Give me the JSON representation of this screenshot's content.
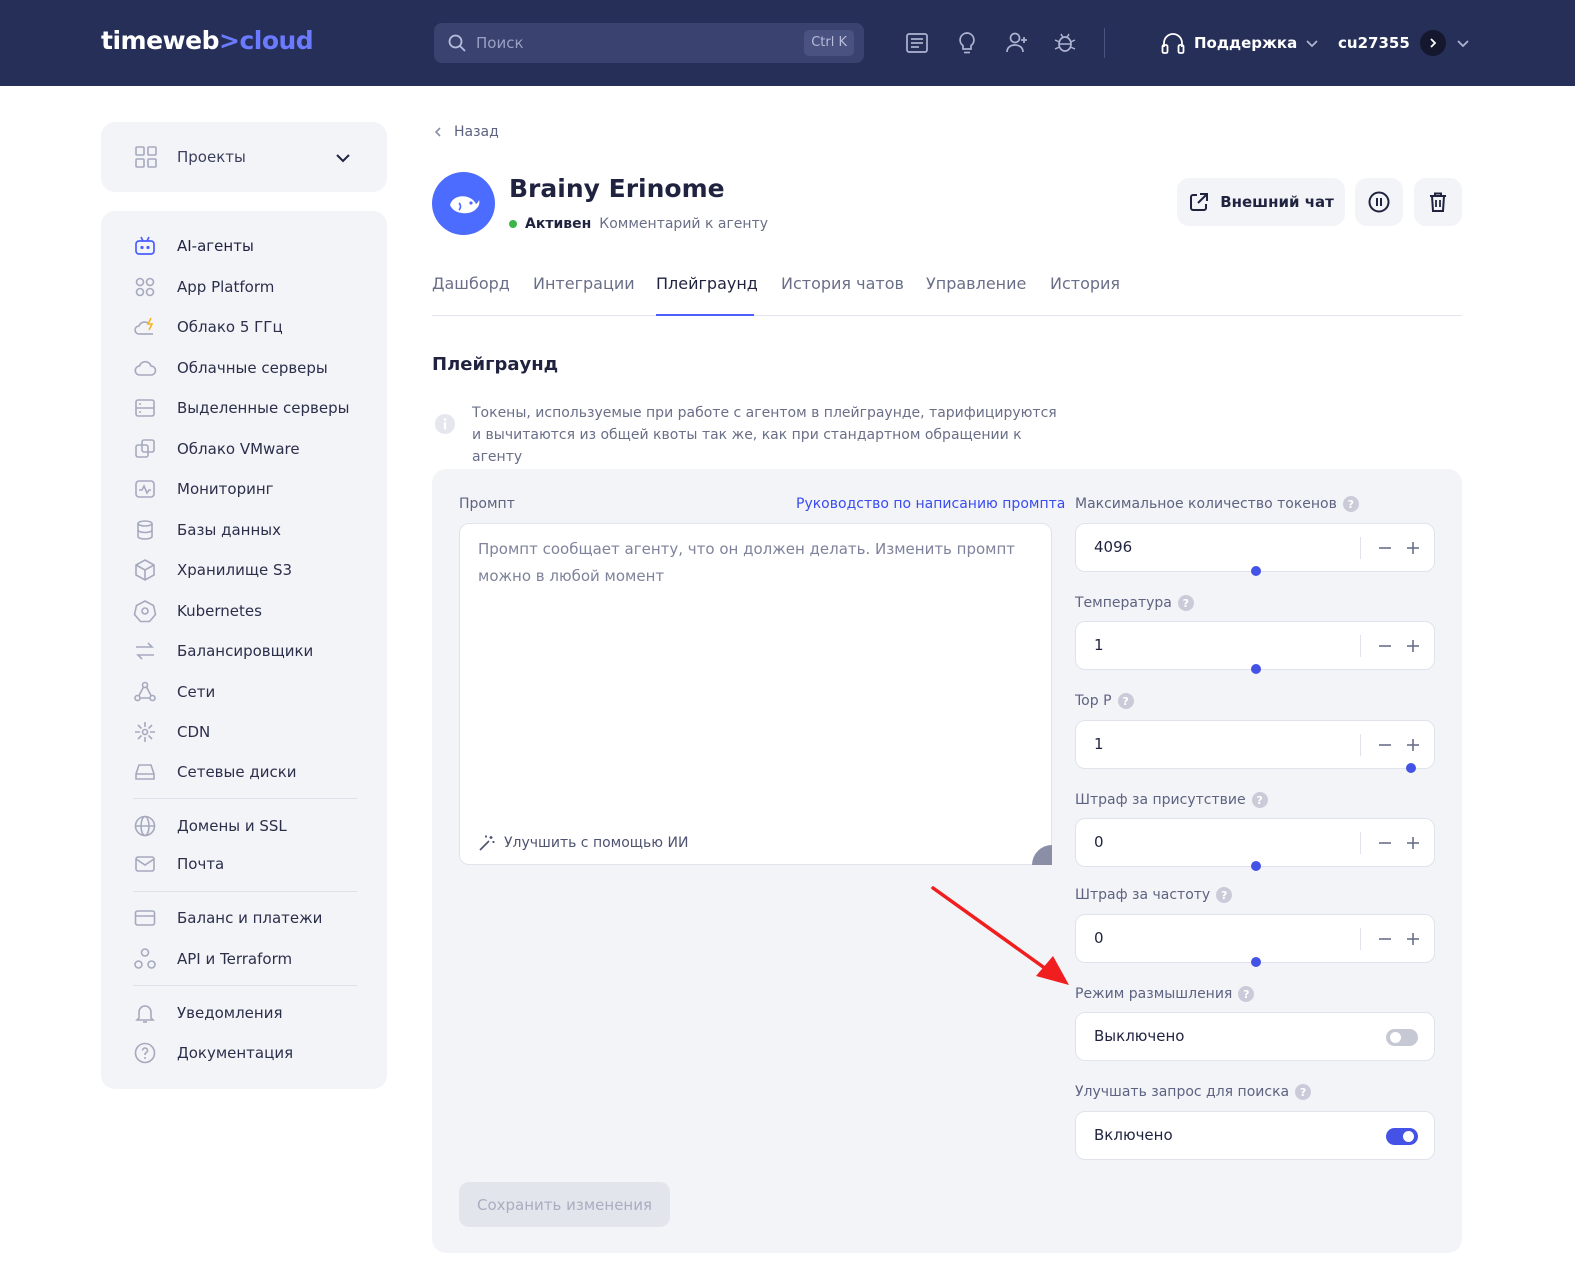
{
  "header": {
    "logo_main": "timeweb",
    "logo_sep": ">",
    "logo_accent": "cloud",
    "search_placeholder": "Поиск",
    "search_shortcut": "Ctrl K",
    "icons": [
      "news-icon",
      "lightbulb-icon",
      "add-user-icon",
      "bug-icon"
    ],
    "support_label": "Поддержка",
    "account_id": "cu27355",
    "bg_color": "#262f57",
    "accent_color": "#6b7bff"
  },
  "sidebar": {
    "projects_label": "Проекты",
    "items": [
      {
        "label": "AI-агенты",
        "icon": "robot-icon"
      },
      {
        "label": "App Platform",
        "icon": "grid-icon"
      },
      {
        "label": "Облако 5 ГГц",
        "icon": "cloud-bolt-icon"
      },
      {
        "label": "Облачные серверы",
        "icon": "cloud-icon"
      },
      {
        "label": "Выделенные серверы",
        "icon": "server-icon"
      },
      {
        "label": "Облако VMware",
        "icon": "vmware-icon"
      },
      {
        "label": "Мониторинг",
        "icon": "monitoring-icon"
      },
      {
        "label": "Базы данных",
        "icon": "database-icon"
      },
      {
        "label": "Хранилище S3",
        "icon": "cube-icon"
      },
      {
        "label": "Kubernetes",
        "icon": "kubernetes-icon"
      },
      {
        "label": "Балансировщики",
        "icon": "balancer-icon"
      },
      {
        "label": "Сети",
        "icon": "network-icon"
      },
      {
        "label": "CDN",
        "icon": "cdn-icon"
      },
      {
        "label": "Сетевые диски",
        "icon": "disk-icon"
      },
      {
        "label": "Домены и SSL",
        "icon": "globe-icon"
      },
      {
        "label": "Почта",
        "icon": "mail-icon"
      },
      {
        "label": "Баланс и платежи",
        "icon": "card-icon"
      },
      {
        "label": "API и Terraform",
        "icon": "api-icon"
      },
      {
        "label": "Уведомления",
        "icon": "bell-icon"
      },
      {
        "label": "Документация",
        "icon": "help-icon"
      }
    ]
  },
  "page": {
    "back_label": "Назад",
    "agent_name": "Brainy Erinome",
    "status": "Активен",
    "comment": "Комментарий к агенту",
    "external_chat_label": "Внешний чат",
    "tabs": [
      "Дашборд",
      "Интеграции",
      "Плейграунд",
      "История чатов",
      "Управление",
      "История"
    ],
    "active_tab": "Плейграунд",
    "section_title": "Плейграунд",
    "info_text": "Токены, используемые при работе с агентом в плейграунде, тарифицируются и вычитаются из общей квоты так же, как при стандартном обращении к агенту"
  },
  "playground": {
    "prompt_label": "Промпт",
    "guide_link": "Руководство по написанию промпта",
    "prompt_placeholder": "Промпт сообщает агенту, что он должен делать. Изменить промпт можно в любой момент",
    "improve_label": "Улучшить с помощью ИИ",
    "params": [
      {
        "label": "Максимальное количество токенов",
        "value": "4096",
        "slider": 0.5
      },
      {
        "label": "Температура",
        "value": "1",
        "slider": 0.5
      },
      {
        "label": "Top P",
        "value": "1",
        "slider": 1.0
      },
      {
        "label": "Штраф за присутствие",
        "value": "0",
        "slider": 0.5
      },
      {
        "label": "Штраф за частоту",
        "value": "0",
        "slider": 0.5
      }
    ],
    "thinking_label": "Режим размышления",
    "thinking_value": "Выключено",
    "thinking_on": false,
    "search_improve_label": "Улучшать запрос для поиска",
    "search_improve_value": "Включено",
    "search_improve_on": true,
    "save_label": "Сохранить изменения",
    "question_mark": "?"
  }
}
